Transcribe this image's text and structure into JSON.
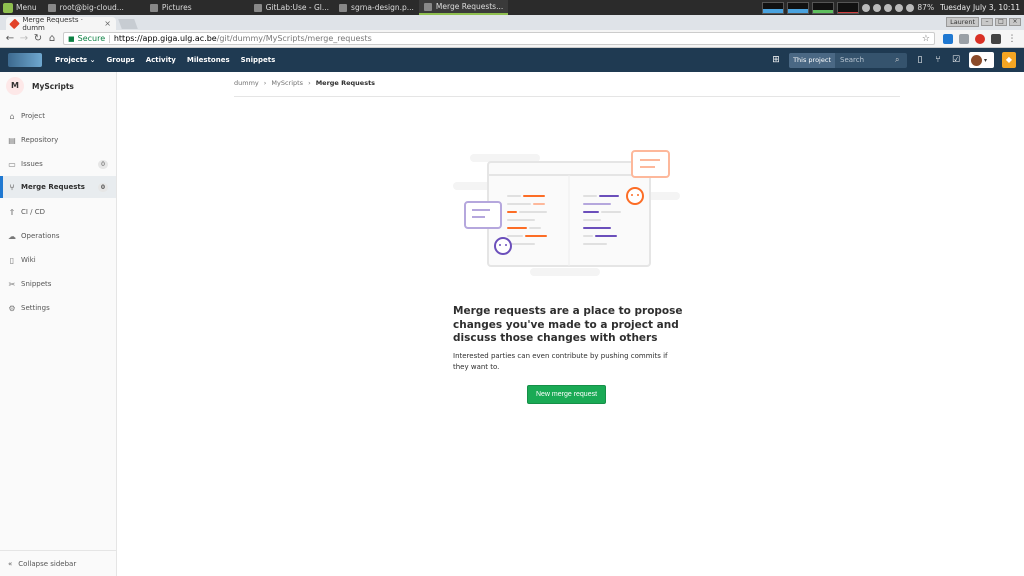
{
  "taskbar": {
    "menu_label": "Menu",
    "tasks": [
      {
        "label": "root@big-cloud..."
      },
      {
        "label": "Pictures"
      },
      {
        "label": "GitLab:Use - Gl..."
      },
      {
        "label": "sgrna-design.p..."
      },
      {
        "label": "Merge Requests..."
      }
    ],
    "battery": "87%",
    "clock": "Tuesday July  3, 10:11"
  },
  "browser": {
    "tab_title": "Merge Requests · dumm",
    "user_button": "Laurent",
    "secure_label": "Secure",
    "url_scheme_host": "https://app.giga.ulg.ac.be",
    "url_path": "/git/dummy/MyScripts/merge_requests"
  },
  "header": {
    "nav": [
      "Projects ⌄",
      "Groups",
      "Activity",
      "Milestones",
      "Snippets"
    ],
    "search_scope": "This project",
    "search_placeholder": "Search"
  },
  "sidebar": {
    "project_initial": "M",
    "project_name": "MyScripts",
    "items": [
      {
        "label": "Project",
        "icon": "home-icon"
      },
      {
        "label": "Repository",
        "icon": "doc-icon"
      },
      {
        "label": "Issues",
        "icon": "issues-icon",
        "badge": "0"
      },
      {
        "label": "Merge Requests",
        "icon": "merge-icon",
        "badge": "0"
      },
      {
        "label": "CI / CD",
        "icon": "rocket-icon"
      },
      {
        "label": "Operations",
        "icon": "cloud-icon"
      },
      {
        "label": "Wiki",
        "icon": "book-icon"
      },
      {
        "label": "Snippets",
        "icon": "scissors-icon"
      },
      {
        "label": "Settings",
        "icon": "gear-icon"
      }
    ],
    "collapse_label": "Collapse sidebar"
  },
  "breadcrumb": {
    "items": [
      "dummy",
      "MyScripts",
      "Merge Requests"
    ]
  },
  "empty_state": {
    "title": "Merge requests are a place to propose changes you've made to a project and discuss those changes with others",
    "description": "Interested parties can even contribute by pushing commits if they want to.",
    "button_label": "New merge request"
  },
  "colors": {
    "header_bg": "#1f3a52",
    "accent_green": "#1aaa55",
    "orange": "#fc6d26",
    "purple": "#6b4fbb"
  }
}
